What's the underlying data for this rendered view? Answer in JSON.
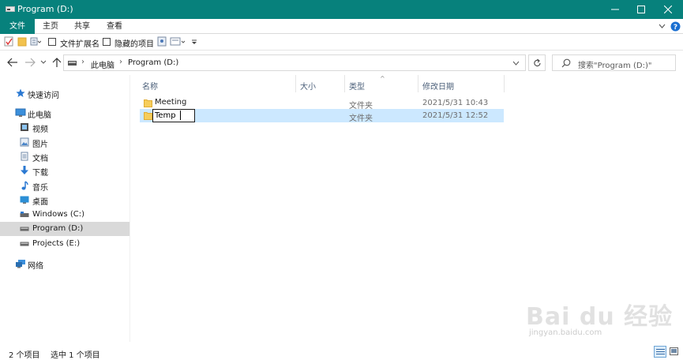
{
  "window": {
    "title": "Program (D:)"
  },
  "ribbon": {
    "tabs": [
      "文件",
      "主页",
      "共享",
      "查看"
    ]
  },
  "quick_access": {
    "file_ext_label": "文件扩展名",
    "hidden_items_label": "隐藏的项目",
    "file_ext_checked": false,
    "hidden_items_checked": false
  },
  "address": {
    "crumbs": [
      "此电脑",
      "Program (D:)"
    ],
    "search_placeholder": "搜索\"Program (D:)\""
  },
  "nav": {
    "items": [
      {
        "label": "快速访问",
        "icon": "star-icon"
      },
      {
        "label": "此电脑",
        "icon": "computer-icon"
      },
      {
        "label": "视频",
        "icon": "video-folder-icon"
      },
      {
        "label": "图片",
        "icon": "pictures-folder-icon"
      },
      {
        "label": "文档",
        "icon": "documents-folder-icon"
      },
      {
        "label": "下载",
        "icon": "download-arrow-icon"
      },
      {
        "label": "音乐",
        "icon": "music-note-icon"
      },
      {
        "label": "桌面",
        "icon": "desktop-folder-icon"
      },
      {
        "label": "Windows (C:)",
        "icon": "windows-drive-icon"
      },
      {
        "label": "Program (D:)",
        "icon": "drive-icon"
      },
      {
        "label": "Projects (E:)",
        "icon": "drive-icon"
      },
      {
        "label": "网络",
        "icon": "network-icon"
      }
    ],
    "selected": "Program (D:)"
  },
  "columns": {
    "name": "名称",
    "size": "大小",
    "type": "类型",
    "modified": "修改日期"
  },
  "files": [
    {
      "name": "Meeting",
      "size": "",
      "type": "文件夹",
      "modified": "2021/5/31 10:43",
      "selected": false
    },
    {
      "name": "Temp",
      "size": "",
      "type": "文件夹",
      "modified": "2021/5/31 12:52",
      "selected": true,
      "renaming": true
    }
  ],
  "status": {
    "item_count": "2 个项目",
    "selection": "选中 1 个项目"
  },
  "watermark": {
    "logo": "Bai du 经验",
    "url": "jingyan.baidu.com"
  },
  "colors": {
    "titlebar": "#07817c",
    "selection": "#cce8ff",
    "nav_selected": "#d9d9d9",
    "header_text": "#4c607a"
  }
}
